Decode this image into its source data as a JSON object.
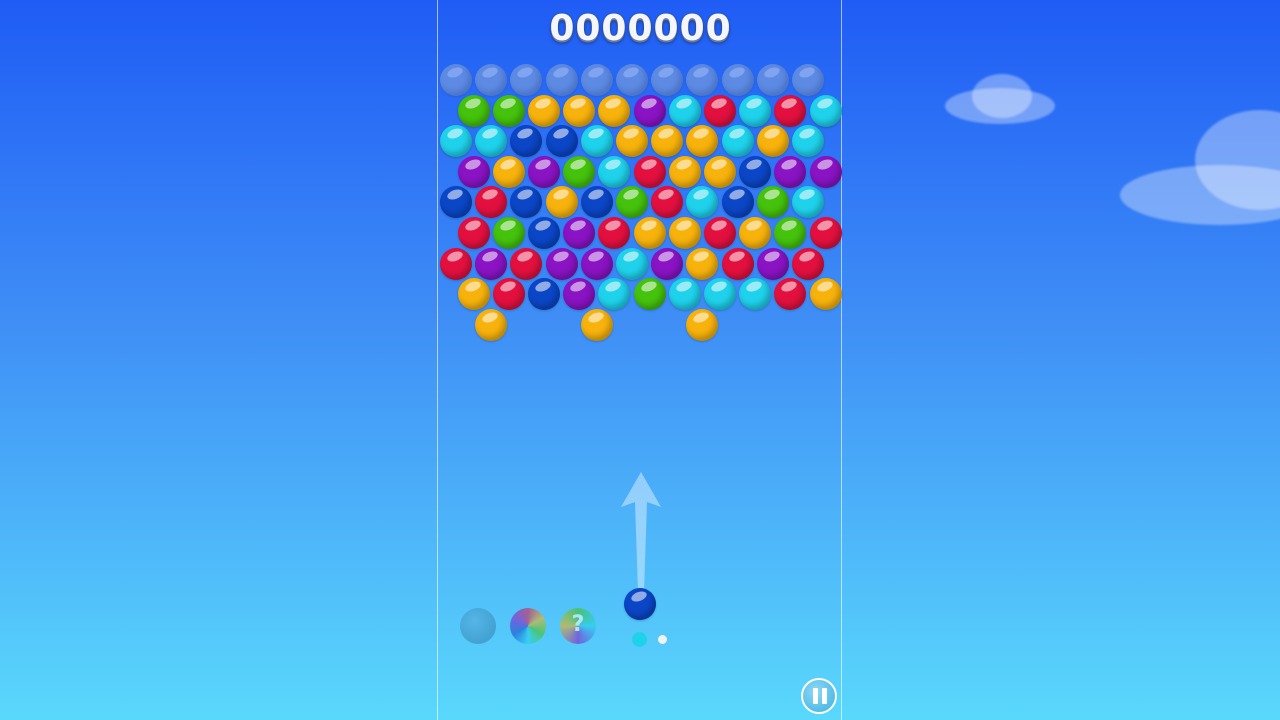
{
  "score": "0000000",
  "colors": {
    "ghost": "#8aa6d6",
    "green": "#44c20c",
    "yellow": "#f7b20c",
    "purple": "#8a13c4",
    "cyan": "#1fd2ec",
    "red": "#e3103f",
    "blue": "#0b46c7"
  },
  "grid": {
    "rows": [
      [
        "ghost",
        "ghost",
        "ghost",
        "ghost",
        "ghost",
        "ghost",
        "ghost",
        "ghost",
        "ghost",
        "ghost",
        "ghost"
      ],
      [
        "green",
        "green",
        "yellow",
        "yellow",
        "yellow",
        "purple",
        "cyan",
        "red",
        "cyan",
        "red",
        "cyan"
      ],
      [
        "cyan",
        "cyan",
        "blue",
        "blue",
        "cyan",
        "yellow",
        "yellow",
        "yellow",
        "cyan",
        "yellow",
        "cyan"
      ],
      [
        "purple",
        "yellow",
        "purple",
        "green",
        "cyan",
        "red",
        "yellow",
        "yellow",
        "blue",
        "purple",
        "purple"
      ],
      [
        "blue",
        "red",
        "blue",
        "yellow",
        "blue",
        "green",
        "red",
        "cyan",
        "blue",
        "green",
        "cyan"
      ],
      [
        "red",
        "green",
        "blue",
        "purple",
        "red",
        "yellow",
        "yellow",
        "red",
        "yellow",
        "green",
        "red"
      ],
      [
        "red",
        "purple",
        "red",
        "purple",
        "purple",
        "cyan",
        "purple",
        "yellow",
        "red",
        "purple",
        "red"
      ],
      [
        "yellow",
        "red",
        "blue",
        "purple",
        "cyan",
        "green",
        "cyan",
        "cyan",
        "cyan",
        "red",
        "yellow"
      ],
      [
        null,
        "yellow",
        null,
        null,
        "yellow",
        null,
        null,
        "yellow",
        null,
        null,
        null
      ]
    ]
  },
  "shooter": {
    "current_color": "blue",
    "next_colors": [
      "cyan",
      "white"
    ]
  },
  "boosters": [
    {
      "icon": "bomb-icon"
    },
    {
      "icon": "rainbow-ball-icon"
    },
    {
      "icon": "question-ball-icon"
    }
  ],
  "pause": {
    "icon": "pause-icon"
  }
}
